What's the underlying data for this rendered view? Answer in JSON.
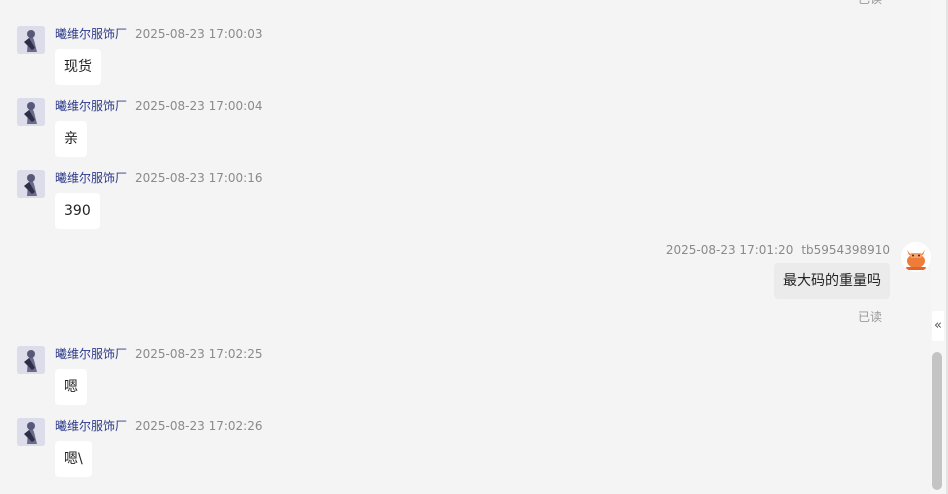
{
  "top_read_status": "已读",
  "messages": [
    {
      "sender": "曦维尔服饰厂",
      "time": "2025-08-23 17:00:03",
      "text": "现货"
    },
    {
      "sender": "曦维尔服饰厂",
      "time": "2025-08-23 17:00:04",
      "text": "亲"
    },
    {
      "sender": "曦维尔服饰厂",
      "time": "2025-08-23 17:00:16",
      "text": "390"
    },
    {
      "sender": "tb5954398910",
      "time": "2025-08-23 17:01:20",
      "text": "最大码的重量吗",
      "status": "已读"
    },
    {
      "sender": "曦维尔服饰厂",
      "time": "2025-08-23 17:02:25",
      "text": "嗯"
    },
    {
      "sender": "曦维尔服饰厂",
      "time": "2025-08-23 17:02:26",
      "text": "嗯\\"
    }
  ],
  "sidebar_toggle": "«",
  "colors": {
    "background": "#f4f4f4",
    "incoming_bubble": "#ffffff",
    "outgoing_bubble": "#ebebeb",
    "sender_name": "#2c3a8a",
    "timestamp": "#8a8a8a",
    "avatar_accent": "#f07c3a"
  },
  "icons": {
    "seller_avatar": "seller-avatar-icon",
    "buyer_avatar": "buyer-avatar-icon",
    "collapse": "double-chevron-left-icon"
  }
}
